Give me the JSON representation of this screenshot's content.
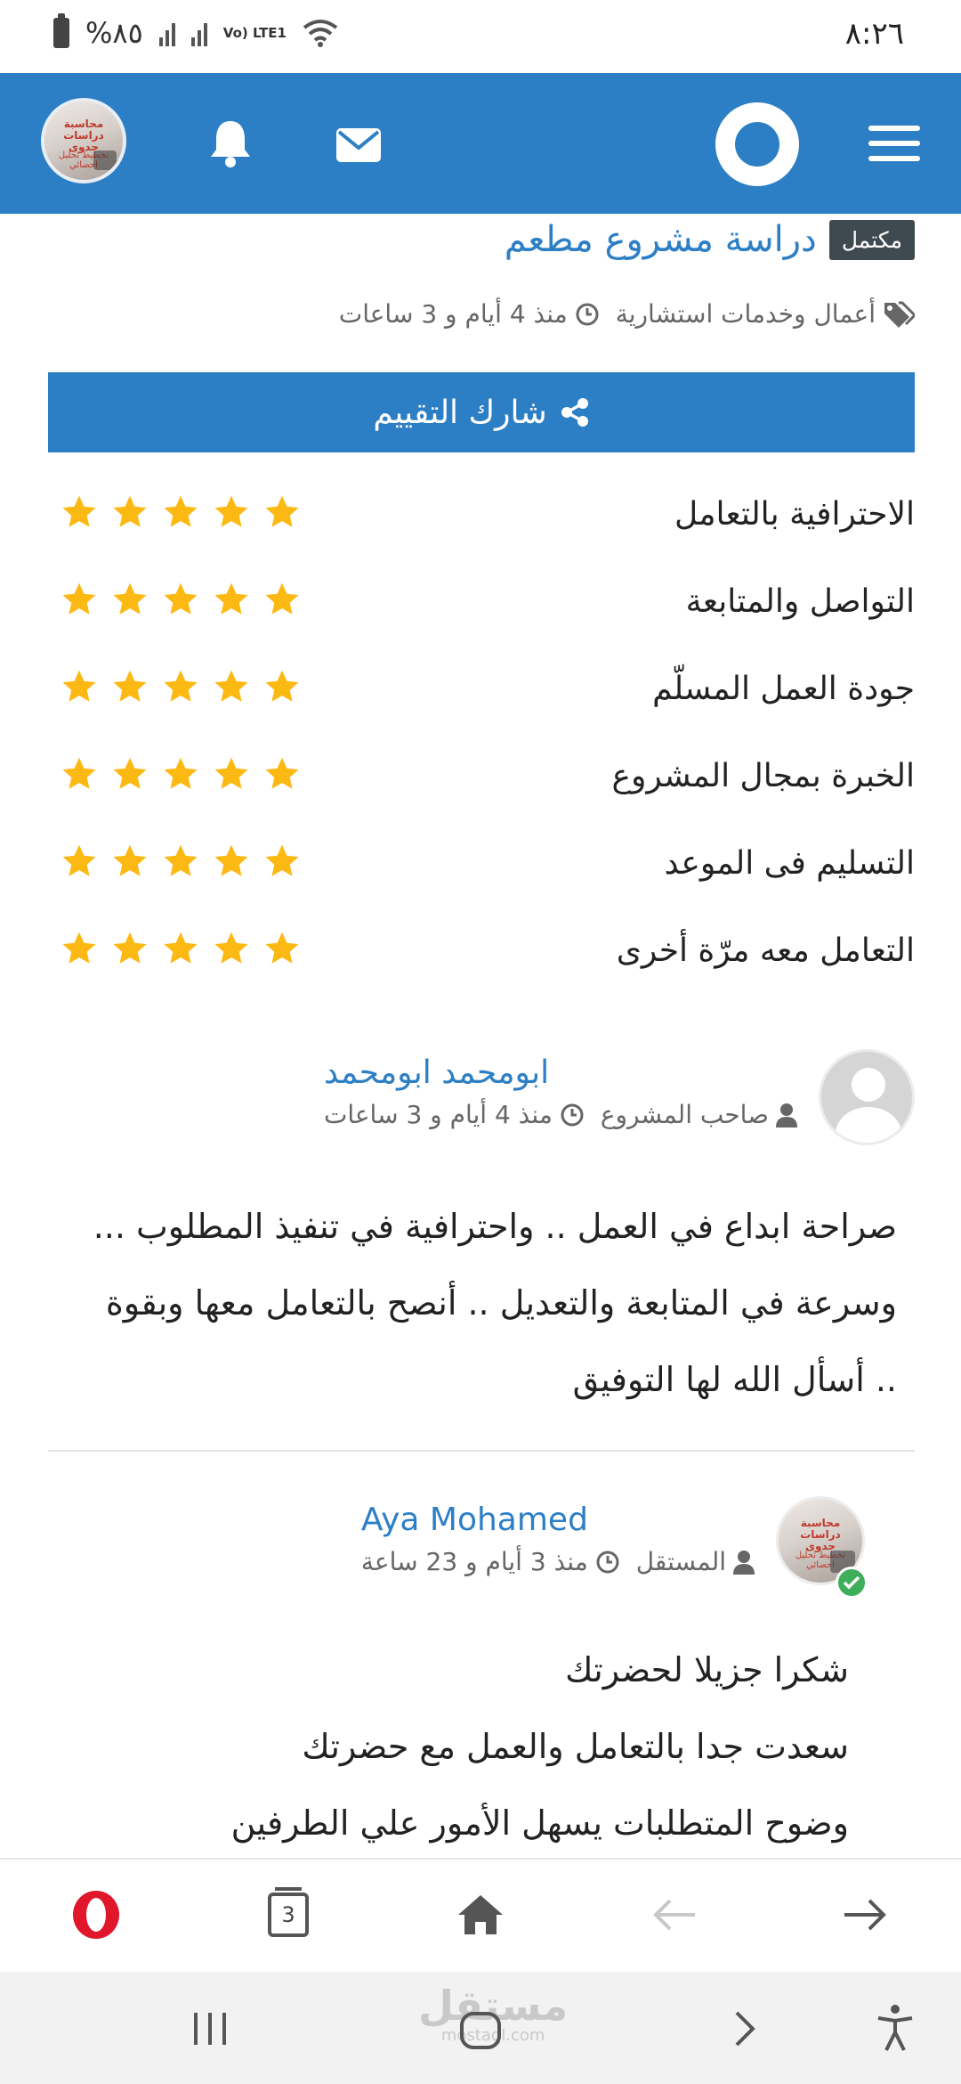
{
  "status_bar": {
    "time": "٨:٢٦",
    "battery": "%٨٥",
    "network": "Vo) LTE1"
  },
  "header": {
    "menu_icon": "hamburger-icon",
    "logo_icon": "ring-logo-icon",
    "mail_icon": "envelope-icon",
    "notifications_icon": "bell-icon",
    "avatar_text_top": "محاسبة دراسات جدوى",
    "avatar_text_bottom": "تخطيط تحليل احصائي"
  },
  "project": {
    "status": "مكتمل",
    "title": "دراسة مشروع مطعم",
    "category": "أعمال وخدمات استشارية",
    "time": "منذ 4 أيام و 3 ساعات"
  },
  "share": {
    "label": "شارك التقييم",
    "icon": "share-icon"
  },
  "ratings": [
    {
      "label": "الاحترافية بالتعامل",
      "stars": 5
    },
    {
      "label": "التواصل والمتابعة",
      "stars": 5
    },
    {
      "label": "جودة العمل المسلّم",
      "stars": 5
    },
    {
      "label": "الخبرة بمجال المشروع",
      "stars": 5
    },
    {
      "label": "التسليم فى الموعد",
      "stars": 5
    },
    {
      "label": "التعامل معه مرّة أخرى",
      "stars": 5
    }
  ],
  "comments": [
    {
      "name": "ابومحمد ابومحمد",
      "role": "صاحب المشروع",
      "time": "منذ 4 أيام و 3 ساعات",
      "lines": [
        "صراحة ابداع في العمل .. واحترافية في تنفيذ المطلوب ...",
        "وسرعة في المتابعة والتعديل .. أنصح بالتعامل معها وبقوة",
        ".. أسأل الله لها التوفيق"
      ]
    },
    {
      "name": "Aya Mohamed",
      "role": "المستقل",
      "time": "منذ 3 أيام و 23 ساعة",
      "lines": [
        "شكرا جزيلا لحضرتك",
        "سعدت جدا بالتعامل والعمل مع حضرتك",
        "وضوح المتطلبات يسهل الأمور علي الطرفين"
      ]
    }
  ],
  "browser_bar": {
    "tabs_count": "3",
    "opera_icon": "opera-icon",
    "home_icon": "home-icon",
    "back_icon": "back-arrow-icon",
    "forward_icon": "forward-arrow-icon"
  },
  "system_nav": {
    "watermark_ar": "مستقل",
    "watermark_en": "mostaql.com"
  },
  "colors": {
    "brand": "#2d7fc5",
    "star": "#fdb913",
    "badge": "#3f4950",
    "verified": "#3fae5a"
  }
}
